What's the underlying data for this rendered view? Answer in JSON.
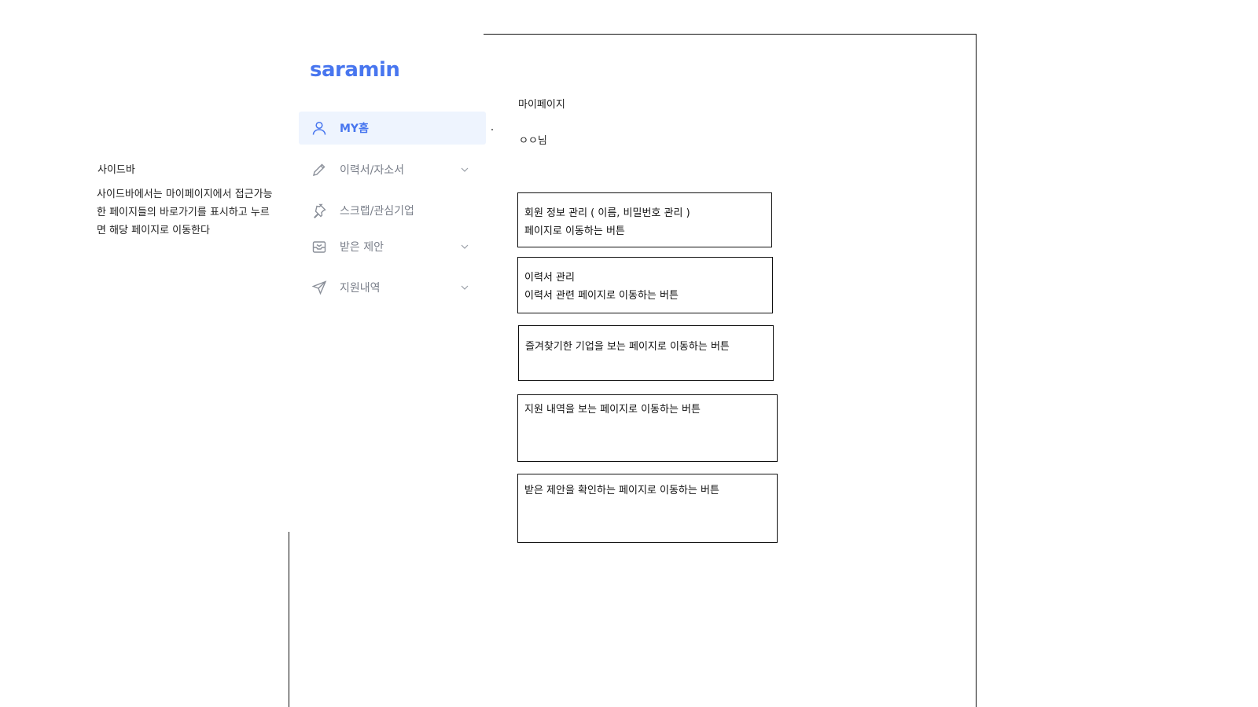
{
  "annotation": {
    "title": "사이드바",
    "body": "사이드바에서는 마이페이지에서 접근가능한 페이지들의 바로가기를 표시하고 누르면 해당 페이지로 이동한다"
  },
  "logo": {
    "text": "saramin"
  },
  "sidebar": {
    "items": [
      {
        "label": "MY홈",
        "icon": "user-icon",
        "active": true,
        "has_chevron": false
      },
      {
        "label": "이력서/자소서",
        "icon": "pencil-icon",
        "active": false,
        "has_chevron": true
      },
      {
        "label": "스크랩/관심기업",
        "icon": "pin-icon",
        "active": false,
        "has_chevron": false
      },
      {
        "label": "받은 제안",
        "icon": "inbox-icon",
        "active": false,
        "has_chevron": true
      },
      {
        "label": "지원내역",
        "icon": "send-icon",
        "active": false,
        "has_chevron": true
      }
    ]
  },
  "main": {
    "page_label": "마이페이지",
    "user_name": "ㅇㅇ님",
    "buttons": [
      {
        "line1": "회원 정보 관리 ( 이름, 비밀번호 관리 )",
        "line2": "페이지로 이동하는 버튼"
      },
      {
        "line1": "이력서 관리",
        "line2": "이력서 관련 페이지로 이동하는 버튼"
      },
      {
        "line1": "즐겨찾기한 기업을 보는 페이지로 이동하는 버튼",
        "line2": ""
      },
      {
        "line1": "지원 내역을 보는 페이지로 이동하는 버튼",
        "line2": ""
      },
      {
        "line1": "받은 제안을 확인하는 페이지로 이동하는 버튼",
        "line2": ""
      }
    ]
  },
  "colors": {
    "accent": "#4876ef",
    "active_bg": "#eef4fe",
    "nav_text": "#7a7f8a"
  }
}
